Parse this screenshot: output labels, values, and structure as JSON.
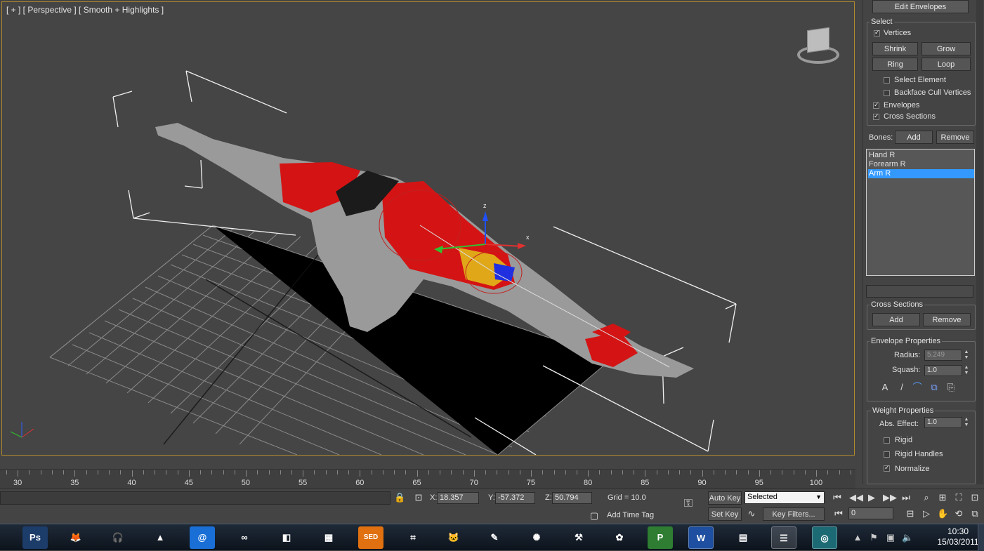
{
  "viewport": {
    "label": "[ + ] [ Perspective ] [ Smooth + Highlights ]"
  },
  "panel": {
    "edit_envelopes": "Edit Envelopes",
    "select_title": "Select",
    "vertices": "Vertices",
    "shrink": "Shrink",
    "grow": "Grow",
    "ring": "Ring",
    "loop": "Loop",
    "select_element": "Select Element",
    "backface_cull": "Backface Cull Vertices",
    "envelopes": "Envelopes",
    "cross_sections": "Cross Sections",
    "bones_label": "Bones:",
    "add": "Add",
    "remove": "Remove",
    "bones": [
      "Hand R",
      "Forearm R",
      "Arm R"
    ],
    "selected_bone": "Arm R",
    "cs_title": "Cross Sections",
    "cs_add": "Add",
    "cs_remove": "Remove",
    "env_title": "Envelope Properties",
    "radius_label": "Radius:",
    "radius": "5.249",
    "squash_label": "Squash:",
    "squash": "1.0",
    "weight_title": "Weight Properties",
    "abs_label": "Abs. Effect:",
    "abs_value": "1.0",
    "rigid": "Rigid",
    "rigid_handles": "Rigid Handles",
    "normalize": "Normalize"
  },
  "timeline": {
    "ticks": [
      "30",
      "35",
      "40",
      "45",
      "50",
      "55",
      "60",
      "65",
      "70",
      "75",
      "80",
      "85",
      "90",
      "95",
      "100"
    ]
  },
  "status": {
    "x_label": "X:",
    "x": "18.357",
    "y_label": "Y:",
    "y": "-57.372",
    "z_label": "Z:",
    "z": "50.794",
    "grid": "Grid = 10.0",
    "auto_key": "Auto Key",
    "selected": "Selected",
    "set_key": "Set Key",
    "key_filters": "Key Filters...",
    "add_time_tag": "Add Time Tag",
    "frame": "0"
  },
  "taskbar": {
    "ps": "Ps",
    "sed": "SED",
    "time": "10:30",
    "date": "15/03/2011"
  },
  "colors": {
    "selection": "#3399ff",
    "viewport_border": "#b18a2c",
    "envelope_red": "#d41414"
  }
}
